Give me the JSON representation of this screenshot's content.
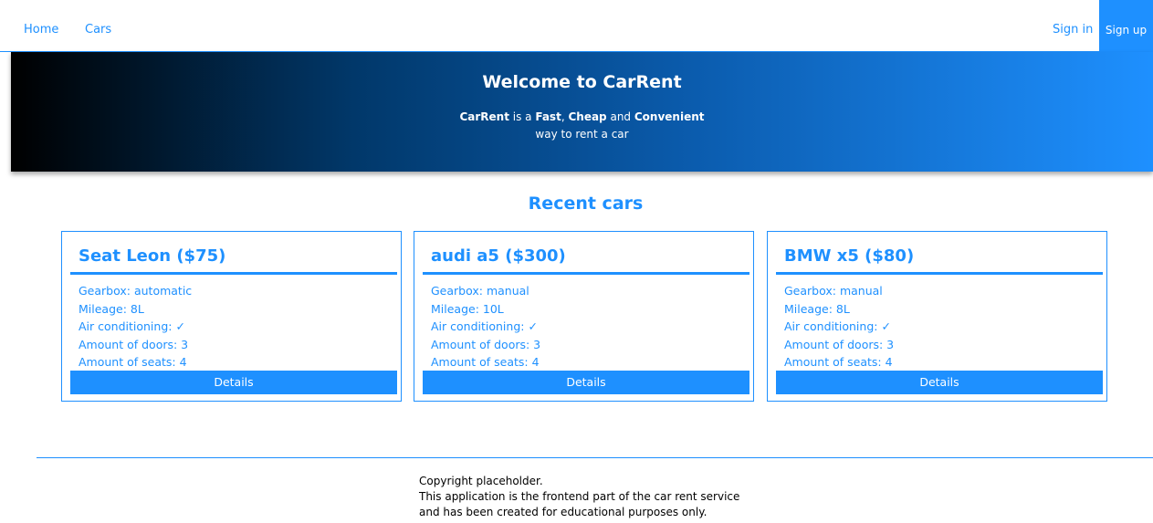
{
  "nav": {
    "home": "Home",
    "cars": "Cars",
    "sign_in": "Sign in",
    "sign_up": "Sign up"
  },
  "hero": {
    "title": "Welcome to CarRent",
    "brand": "CarRent",
    "is_a": " is a ",
    "fast": "Fast",
    "comma": ", ",
    "cheap": "Cheap",
    "and": " and ",
    "convenient": "Convenient",
    "line2": "way to rent a car"
  },
  "recent": {
    "title": "Recent cars",
    "cards": [
      {
        "title": "Seat Leon ($75)",
        "gearbox": "Gearbox: automatic",
        "mileage": "Mileage: 8L",
        "air": "Air conditioning: ✓",
        "doors": "Amount of doors: 3",
        "seats": "Amount of seats: 4",
        "button": "Details"
      },
      {
        "title": "audi a5 ($300)",
        "gearbox": "Gearbox: manual",
        "mileage": "Mileage: 10L",
        "air": "Air conditioning: ✓",
        "doors": "Amount of doors: 3",
        "seats": "Amount of seats: 4",
        "button": "Details"
      },
      {
        "title": "BMW x5 ($80)",
        "gearbox": "Gearbox: manual",
        "mileage": "Mileage: 8L",
        "air": "Air conditioning: ✓",
        "doors": "Amount of doors: 3",
        "seats": "Amount of seats: 4",
        "button": "Details"
      }
    ]
  },
  "footer": {
    "line1": "Copyright placeholder.",
    "line2": "This application is the frontend part of the car rent service",
    "line3": "and has been created for educational purposes only."
  },
  "colors": {
    "accent": "#1e90ff",
    "footer_text": "#000000"
  }
}
